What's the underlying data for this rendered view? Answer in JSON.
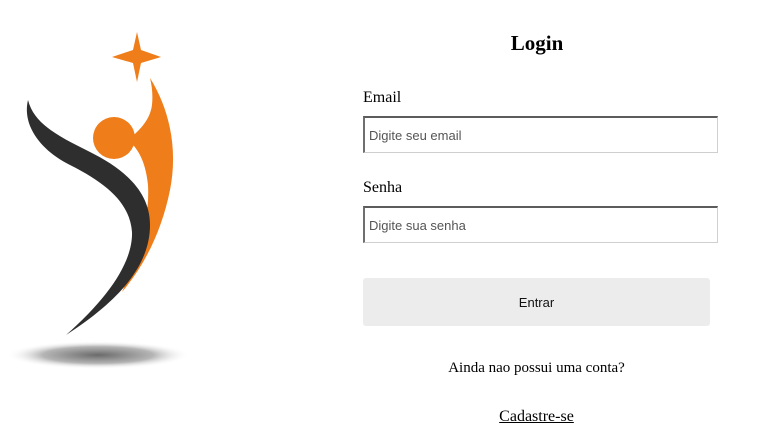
{
  "form": {
    "title": "Login",
    "email_label": "Email",
    "email_placeholder": "Digite seu email",
    "password_label": "Senha",
    "password_placeholder": "Digite sua senha",
    "submit_label": "Entrar",
    "signup_prompt": "Ainda nao possui uma conta?",
    "signup_link": "Cadastre-se"
  },
  "colors": {
    "logo_orange": "#ef7d1a",
    "logo_dark": "#2e2e2e",
    "button_bg": "#ececec"
  }
}
